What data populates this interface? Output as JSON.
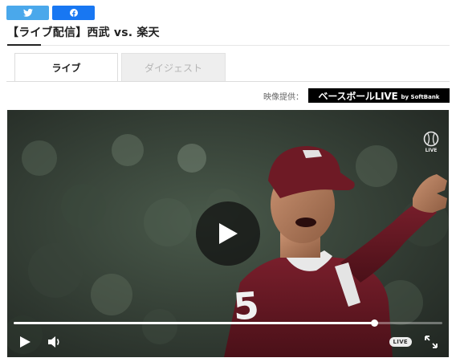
{
  "share": {
    "twitter_icon": "twitter-bird-icon",
    "facebook_icon": "facebook-icon",
    "twitter_color": "#4aa8eb",
    "facebook_color": "#1877f2"
  },
  "article": {
    "title": "【ライブ配信】西武 vs. 楽天"
  },
  "tabs": [
    {
      "label": "ライブ",
      "active": true
    },
    {
      "label": "ダイジェスト",
      "active": false
    }
  ],
  "provider": {
    "label": "映像提供：",
    "logo_main": "ベースボールLIVE",
    "logo_sub": "by SoftBank"
  },
  "player": {
    "jersey_number": "5",
    "corner_badge": "LIVE",
    "live_label": "LIVE",
    "progress": 0.84,
    "icons": {
      "center": "play-icon",
      "play": "play-icon",
      "volume": "volume-icon",
      "fullscreen": "fullscreen-icon"
    }
  }
}
